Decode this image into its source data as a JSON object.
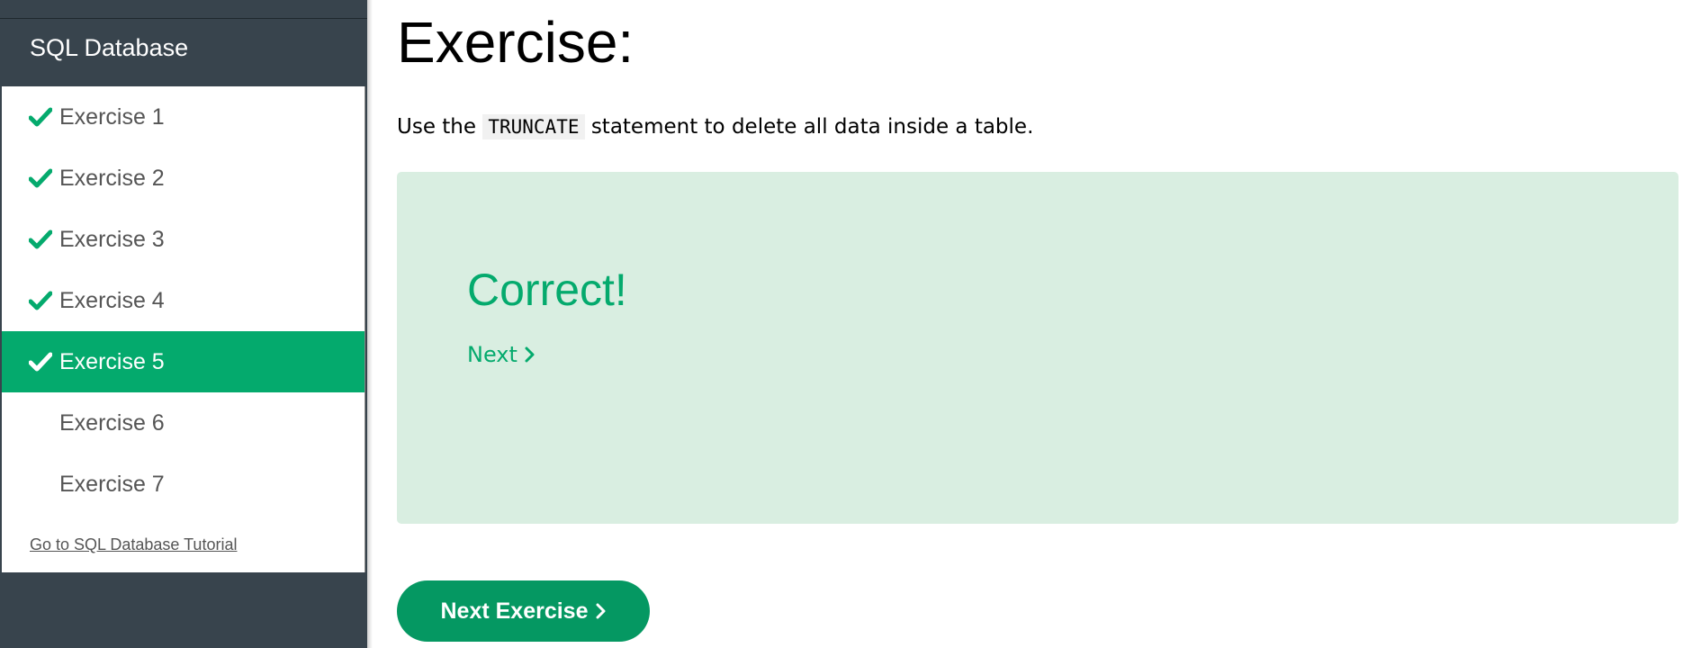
{
  "sidebar": {
    "title": "SQL Database",
    "items": [
      {
        "label": "Exercise 1",
        "completed": true,
        "active": false
      },
      {
        "label": "Exercise 2",
        "completed": true,
        "active": false
      },
      {
        "label": "Exercise 3",
        "completed": true,
        "active": false
      },
      {
        "label": "Exercise 4",
        "completed": true,
        "active": false
      },
      {
        "label": "Exercise 5",
        "completed": true,
        "active": true
      },
      {
        "label": "Exercise 6",
        "completed": false,
        "active": false
      },
      {
        "label": "Exercise 7",
        "completed": false,
        "active": false
      }
    ],
    "tutorial_link": "Go to SQL Database Tutorial"
  },
  "main": {
    "title": "Exercise:",
    "instruction_prefix": "Use the",
    "instruction_code": "TRUNCATE",
    "instruction_suffix": "statement to delete all data inside a table.",
    "result": {
      "heading": "Correct!",
      "next_label": "Next"
    },
    "next_exercise_label": "Next Exercise"
  },
  "colors": {
    "accent": "#04aa6d",
    "sidebar_bg": "#38444d",
    "result_bg": "#d9eee1"
  },
  "icons": {
    "check": "check-icon",
    "chevron": "chevron-right-icon"
  }
}
